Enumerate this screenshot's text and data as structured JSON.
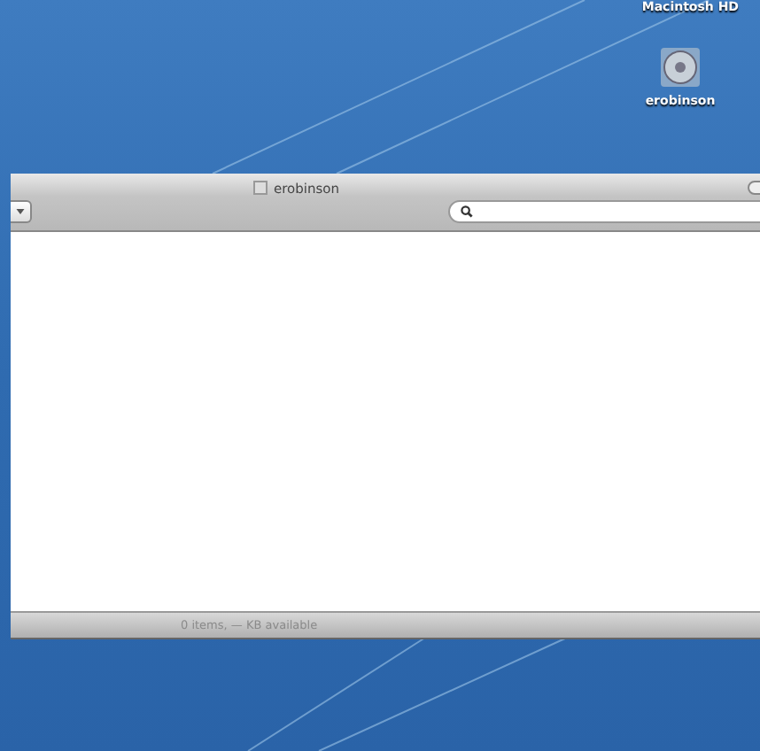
{
  "desktop": {
    "icons": [
      {
        "label": "Macintosh HD"
      },
      {
        "label": "erobinson"
      }
    ]
  },
  "window": {
    "title": "erobinson",
    "status_bar": "0 items, — KB available"
  }
}
